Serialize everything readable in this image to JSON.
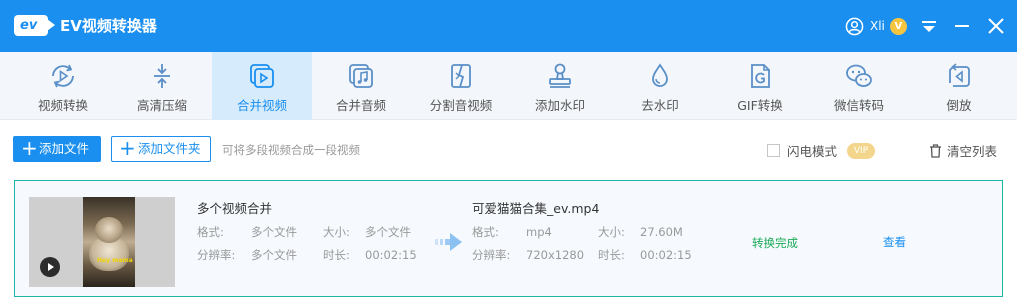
{
  "titlebar": {
    "logo_text": "ev",
    "title": "EV视频转换器",
    "username": "Xli",
    "vip_letter": "V",
    "icons": [
      "user-icon",
      "menu-icon",
      "minimize-icon",
      "close-icon"
    ]
  },
  "toolbar": {
    "items": [
      {
        "label": "视频转换",
        "icon": "video-convert-icon"
      },
      {
        "label": "高清压缩",
        "icon": "compress-icon"
      },
      {
        "label": "合并视频",
        "icon": "merge-video-icon",
        "active": true
      },
      {
        "label": "合并音频",
        "icon": "merge-audio-icon"
      },
      {
        "label": "分割音视频",
        "icon": "split-icon"
      },
      {
        "label": "添加水印",
        "icon": "stamp-icon"
      },
      {
        "label": "去水印",
        "icon": "drop-icon"
      },
      {
        "label": "GIF转换",
        "icon": "gif-icon"
      },
      {
        "label": "微信转码",
        "icon": "wechat-icon"
      },
      {
        "label": "倒放",
        "icon": "reverse-icon"
      }
    ]
  },
  "actions": {
    "add_file": "添加文件",
    "add_folder": "添加文件夹",
    "hint": "可将多段视频合成一段视频",
    "flash_mode": "闪电模式",
    "vip": "VIP",
    "clear_list": "清空列表"
  },
  "file": {
    "thumb_tag": "Hey mama",
    "source": {
      "name": "多个视频合并",
      "format_label": "格式:",
      "format": "多个文件",
      "size_label": "大小:",
      "size": "多个文件",
      "resolution_label": "分辨率:",
      "resolution": "多个文件",
      "duration_label": "时长:",
      "duration": "00:02:15"
    },
    "output": {
      "name": "可爱猫猫合集_ev.mp4",
      "format_label": "格式:",
      "format": "mp4",
      "size_label": "大小:",
      "size": "27.60M",
      "resolution_label": "分辨率:",
      "resolution": "720x1280",
      "duration_label": "时长:",
      "duration": "00:02:15"
    },
    "status": "转换完成",
    "view": "查看"
  },
  "colors": {
    "primary": "#1a8ff0",
    "success": "#1aaa55",
    "card_border": "#1cb5a8",
    "vip_gold": "#f5c542"
  }
}
